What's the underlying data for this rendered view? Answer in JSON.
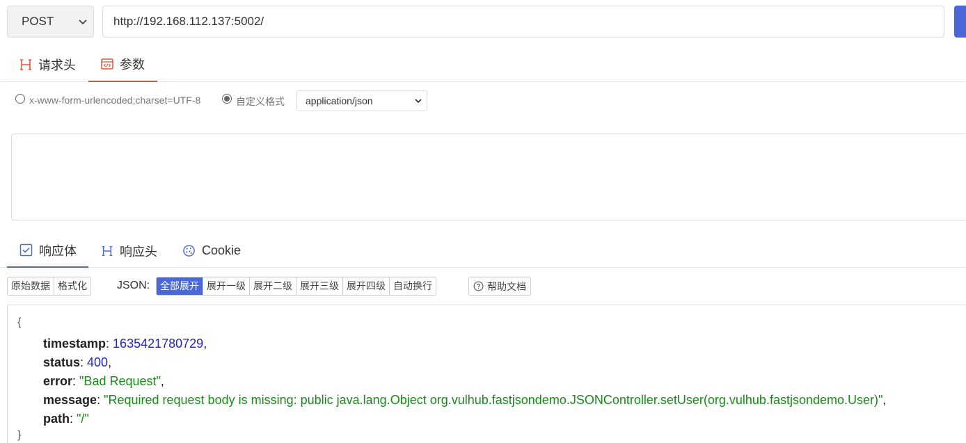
{
  "request": {
    "method": "POST",
    "url": "http://192.168.112.137:5002/"
  },
  "request_tabs": [
    {
      "label": "请求头",
      "icon": "header-h-icon",
      "active": false
    },
    {
      "label": "参数",
      "icon": "code-window-icon",
      "active": true
    }
  ],
  "body_format": {
    "option_urlencoded": "x-www-form-urlencoded;charset=UTF-8",
    "option_custom": "自定义格式",
    "selected": "custom",
    "content_type": "application/json"
  },
  "response_tabs": [
    {
      "label": "响应体",
      "icon": "checkbox-icon",
      "active": true
    },
    {
      "label": "响应头",
      "icon": "header-h-icon",
      "active": false
    },
    {
      "label": "Cookie",
      "icon": "cookie-icon",
      "active": false
    }
  ],
  "toolbar": {
    "view_raw": "原始数据",
    "view_formatted": "格式化",
    "json_label": "JSON:",
    "expand_all": "全部展开",
    "expand_1": "展开一级",
    "expand_2": "展开二级",
    "expand_3": "展开三级",
    "expand_4": "展开四级",
    "word_wrap": "自动换行",
    "help": "帮助文档"
  },
  "response_json": {
    "open_brace": "{",
    "close_brace": "}",
    "fields": [
      {
        "key": "timestamp",
        "value": "1635421780729",
        "type": "number"
      },
      {
        "key": "status",
        "value": "400",
        "type": "number"
      },
      {
        "key": "error",
        "value": "\"Bad Request\"",
        "type": "string"
      },
      {
        "key": "message",
        "value": "\"Required request body is missing: public java.lang.Object org.vulhub.fastjsondemo.JSONController.setUser(org.vulhub.fastjsondemo.User)\"",
        "type": "string"
      },
      {
        "key": "path",
        "value": "\"/\"",
        "type": "string"
      }
    ]
  },
  "colors": {
    "accent_blue": "#4a68d8",
    "accent_red": "#e0533e",
    "json_number": "#2222cc",
    "json_string": "#188a18"
  }
}
